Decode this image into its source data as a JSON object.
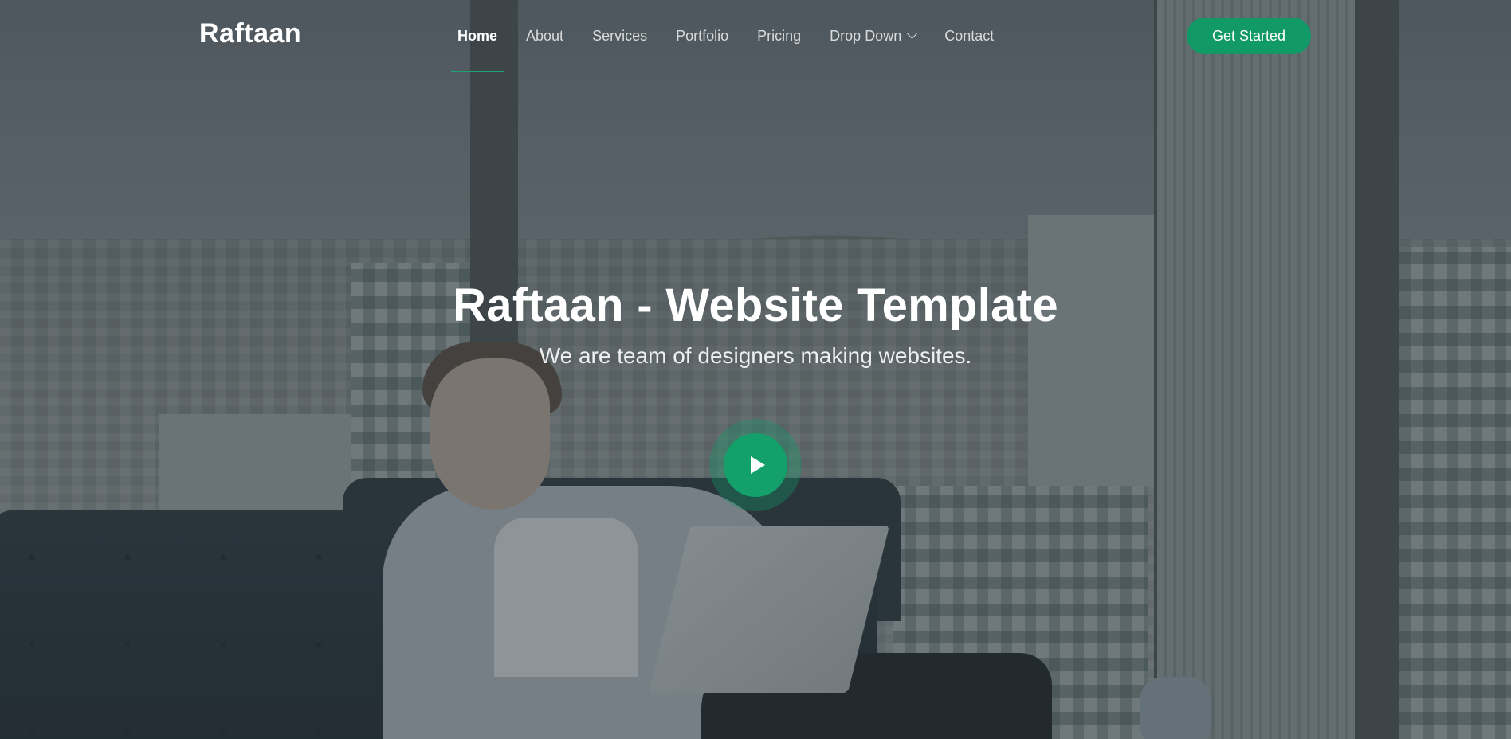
{
  "header": {
    "logo": "Raftaan",
    "nav": [
      {
        "label": "Home",
        "active": true
      },
      {
        "label": "About"
      },
      {
        "label": "Services"
      },
      {
        "label": "Portfolio"
      },
      {
        "label": "Pricing"
      },
      {
        "label": "Drop Down",
        "has_dropdown": true
      },
      {
        "label": "Contact"
      }
    ],
    "cta_label": "Get Started"
  },
  "hero": {
    "title": "Raftaan - Website Template",
    "subtitle": "We are team of designers making websites.",
    "play_icon": "play-icon"
  },
  "colors": {
    "accent": "#119a66",
    "text": "#ffffff"
  }
}
